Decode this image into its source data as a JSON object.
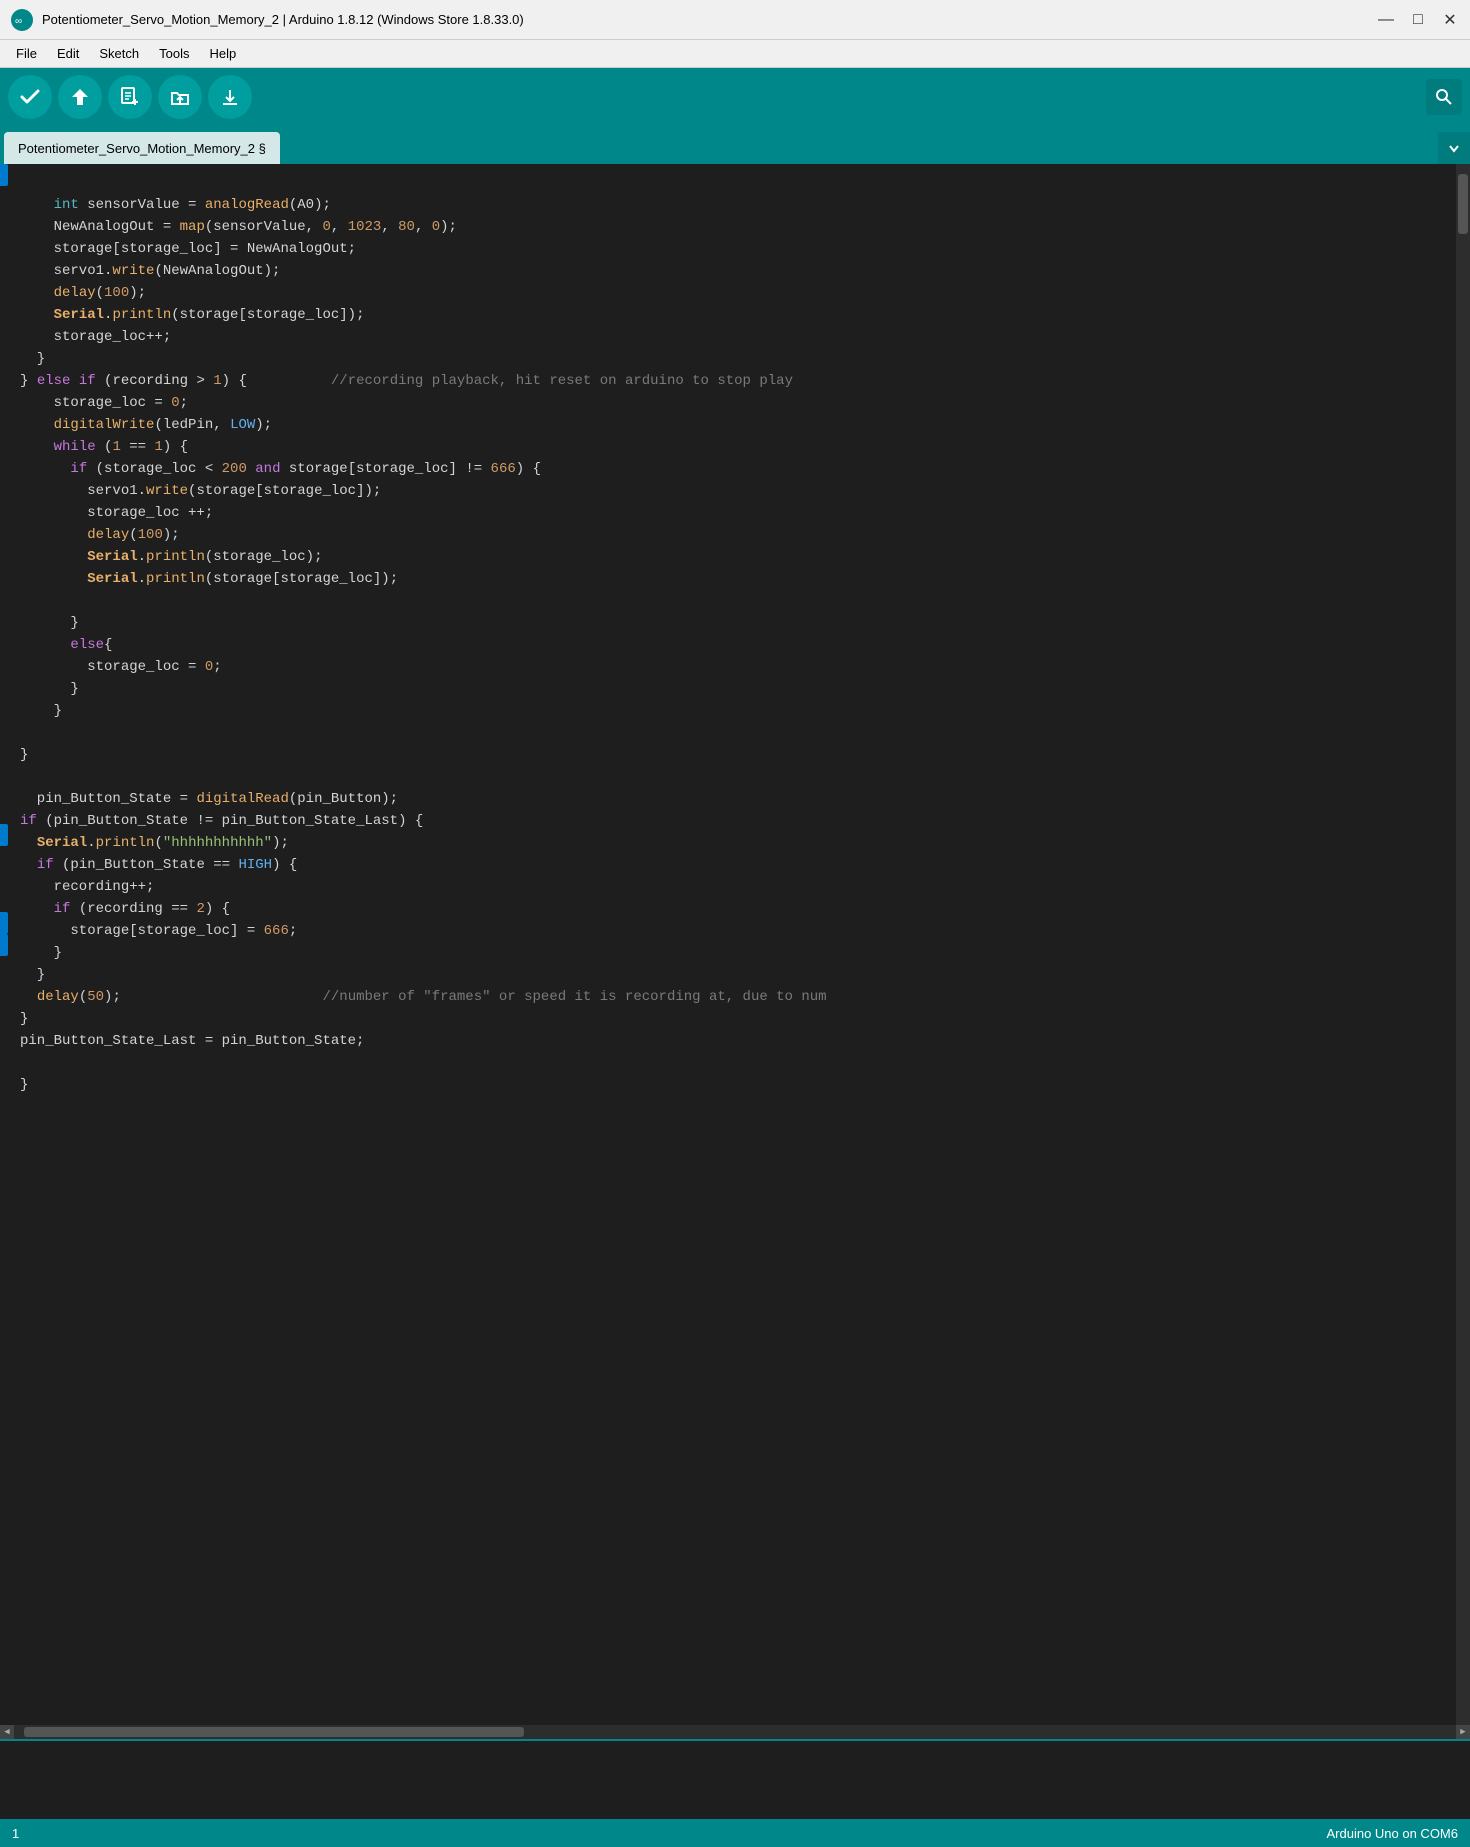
{
  "titleBar": {
    "title": "Potentiometer_Servo_Motion_Memory_2 | Arduino 1.8.12 (Windows Store 1.8.33.0)",
    "minimizeLabel": "—",
    "maximizeLabel": "□",
    "closeLabel": "✕"
  },
  "menuBar": {
    "items": [
      "File",
      "Edit",
      "Sketch",
      "Tools",
      "Help"
    ]
  },
  "toolbar": {
    "verifyLabel": "✓",
    "uploadLabel": "→",
    "newLabel": "📄",
    "openLabel": "↑",
    "saveLabel": "↓",
    "searchLabel": "🔍"
  },
  "tab": {
    "label": "Potentiometer_Servo_Motion_Memory_2 §"
  },
  "statusBar": {
    "left": "1",
    "right": "Arduino Uno on COM6"
  },
  "code": {
    "lines": [
      {
        "num": "",
        "content": ""
      },
      {
        "num": "",
        "content": ""
      }
    ]
  }
}
